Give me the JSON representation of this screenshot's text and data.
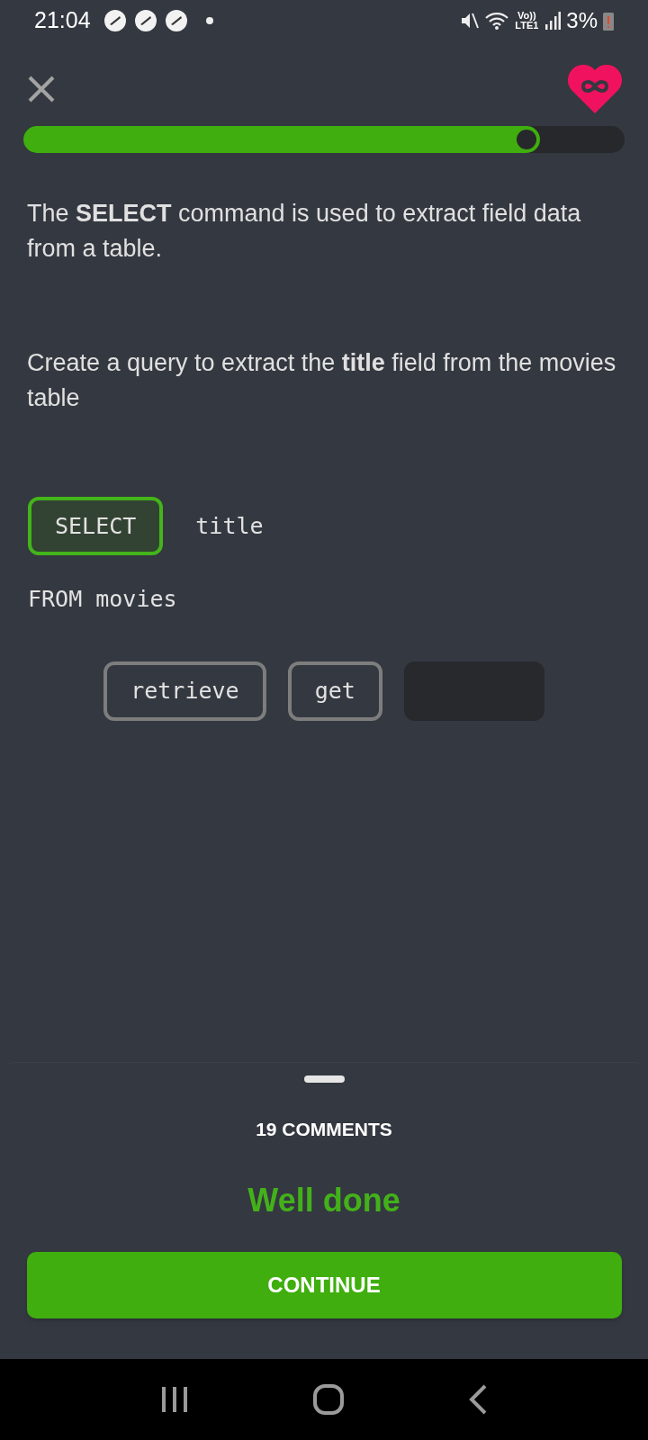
{
  "status_bar": {
    "time": "21:04",
    "battery": "3%",
    "network": "Vo)) LTE1"
  },
  "progress": {
    "level": 0.86
  },
  "paragraphs": [
    "The **SELECT** command is used to extract field data from a table.",
    "Create a query to extract the **title** field from the movies table"
  ],
  "code_lines": [
    [
      {
        "kind": "chip",
        "text": "SELECT",
        "correct": true
      },
      {
        "kind": "text",
        "text": "title"
      }
    ],
    [
      {
        "kind": "text",
        "text": "FROM movies"
      }
    ]
  ],
  "options": [
    {
      "label": "retrieve",
      "used": false
    },
    {
      "label": "get",
      "used": false
    },
    {
      "used": true
    }
  ],
  "sheet": {
    "comments": "19 COMMENTS",
    "result": "Well done",
    "button": "CONTINUE"
  }
}
